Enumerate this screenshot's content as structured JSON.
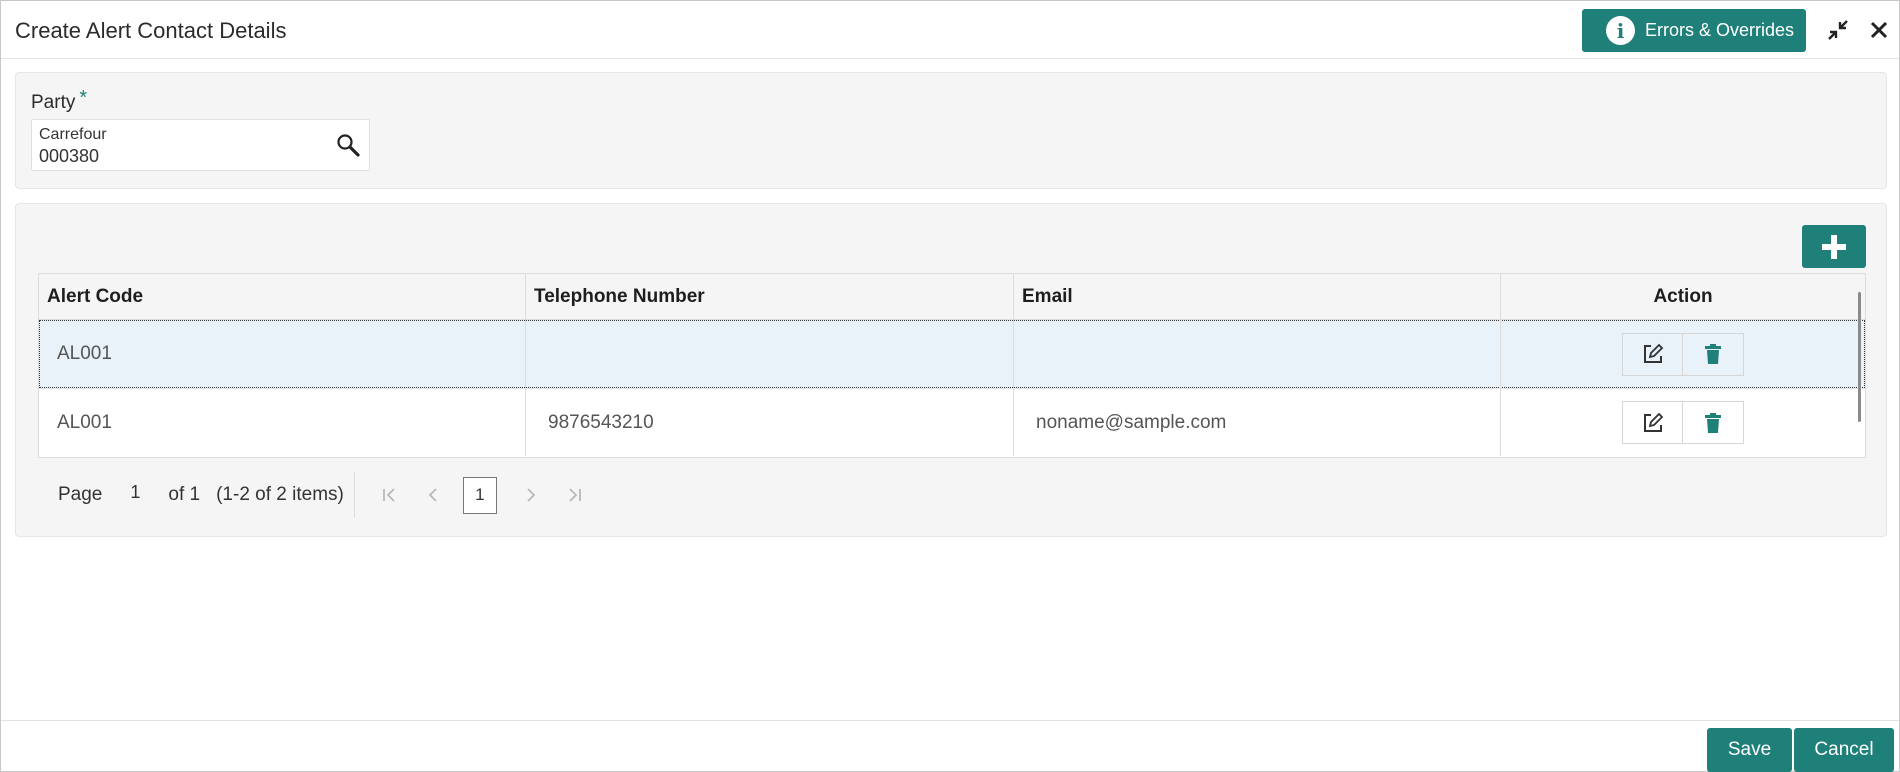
{
  "header": {
    "title": "Create Alert Contact Details",
    "errors_label": "Errors & Overrides",
    "info_glyph": "i"
  },
  "party": {
    "label": "Party",
    "required_mark": "*",
    "name": "Carrefour",
    "code": "000380"
  },
  "grid": {
    "columns": [
      "Alert Code",
      "Telephone Number",
      "Email",
      "Action"
    ],
    "rows": [
      {
        "alert_code": "AL001",
        "telephone": "",
        "email": ""
      },
      {
        "alert_code": "AL001",
        "telephone": "9876543210",
        "email": "noname@sample.com"
      }
    ]
  },
  "pager": {
    "page_label": "Page",
    "page_value": "1",
    "of_label": "of 1",
    "count_label": "(1-2 of 2 items)",
    "current_page": "1"
  },
  "footer": {
    "save_label": "Save",
    "cancel_label": "Cancel"
  },
  "colors": {
    "accent": "#1f7f79",
    "selected_row": "#e8f2f8",
    "panel_bg": "#f5f5f5"
  },
  "icons": [
    "info-icon",
    "collapse-icon",
    "close-icon",
    "search-icon",
    "plus-icon",
    "edit-icon",
    "trash-icon",
    "first-page-icon",
    "prev-page-icon",
    "next-page-icon",
    "last-page-icon"
  ]
}
